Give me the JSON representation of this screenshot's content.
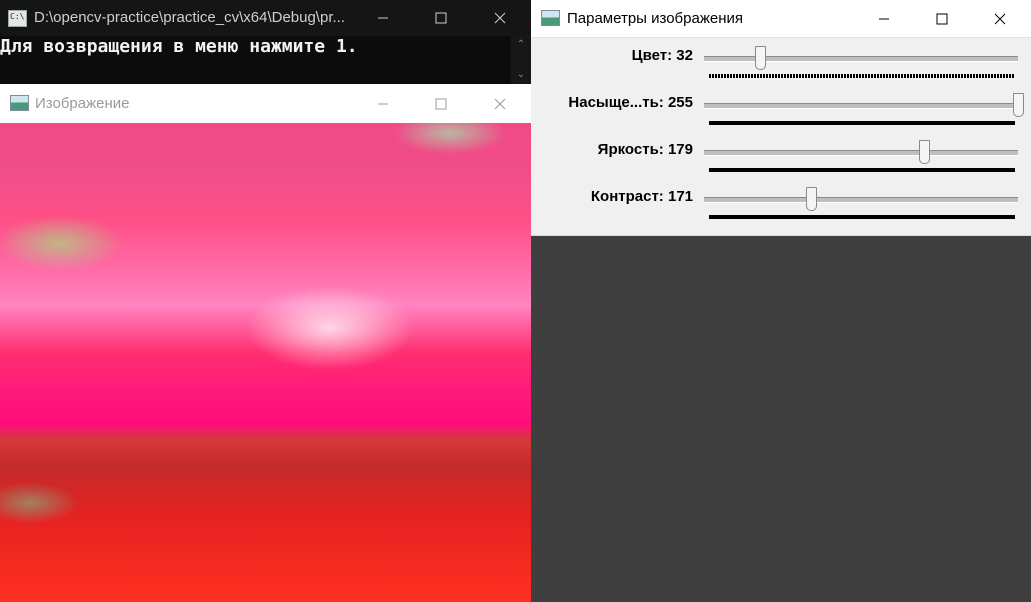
{
  "console": {
    "title": "D:\\opencv-practice\\practice_cv\\x64\\Debug\\pr...",
    "output_line": "Для возвращения в меню нажмите 1."
  },
  "image_window": {
    "title": "Изображение"
  },
  "params_window": {
    "title": "Параметры изображения",
    "trackbars": [
      {
        "label": "Цвет: 32",
        "value": 32,
        "max": 180
      },
      {
        "label": "Насыще...ть: 255",
        "value": 255,
        "max": 255
      },
      {
        "label": "Яркость: 179",
        "value": 179,
        "max": 255
      },
      {
        "label": "Контраст: 171",
        "value": 171,
        "max": 500
      }
    ]
  },
  "icons": {
    "console_app": "console-app-icon",
    "image_app": "image-window-icon",
    "minimize": "minimize-icon",
    "maximize": "maximize-icon",
    "close": "close-icon"
  },
  "colors": {
    "console_bg": "#0c0c0c",
    "desktop_bg": "#3f3f3f",
    "params_bg": "#f0f0f0"
  }
}
